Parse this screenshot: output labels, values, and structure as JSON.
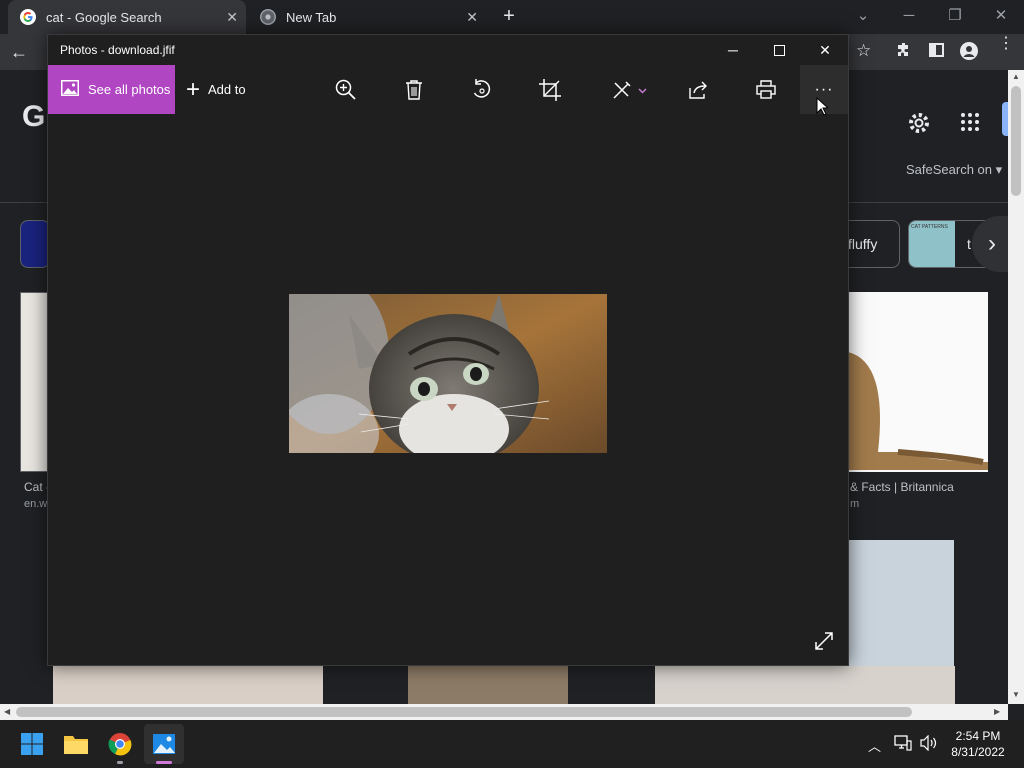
{
  "chrome": {
    "tabs": [
      {
        "title": "cat - Google Search",
        "active": true
      },
      {
        "title": "New Tab",
        "active": false
      }
    ],
    "new_tab_symbol": "+"
  },
  "google": {
    "logo_partial": "G",
    "safesearch": "SafeSearch on",
    "chips": [
      {
        "label": "fluffy"
      },
      {
        "label": "t"
      }
    ],
    "chip_thumb_text": "CAT PATTERNS",
    "captions": [
      {
        "title": "Cat -",
        "source": "en.w"
      },
      {
        "title": "& Facts | Britannica",
        "source": "m"
      }
    ]
  },
  "photos": {
    "title": "Photos - download.jfif",
    "see_all": "See all photos",
    "add_to": "Add to",
    "more_symbol": "···",
    "tools": [
      "zoom-icon",
      "delete-icon",
      "rotate-icon",
      "crop-icon",
      "edit-icon",
      "share-icon",
      "print-icon",
      "more-icon"
    ]
  },
  "taskbar": {
    "time": "2:54 PM",
    "date": "8/31/2022"
  },
  "colors": {
    "accent": "#b146c2",
    "window_bg": "#1f1f1f",
    "chrome_bg": "#202124"
  }
}
